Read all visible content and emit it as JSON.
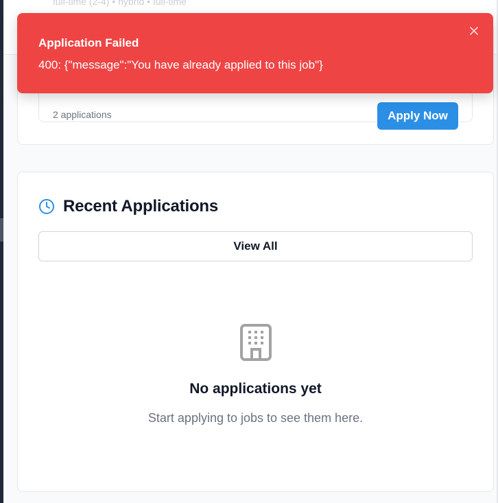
{
  "top_bar": {
    "faded_text": "full-time (2-4) • hybrid • full-time"
  },
  "job_card": {
    "applications_count": "2 applications",
    "apply_button_label": "Apply Now"
  },
  "toast": {
    "title": "Application Failed",
    "message": "400: {\"message\":\"You have already applied to this job\"}",
    "close_icon": "close-icon",
    "color": "#ef4444"
  },
  "recent_applications": {
    "icon": "clock-icon",
    "title": "Recent Applications",
    "view_all_label": "View All",
    "empty_icon": "building-icon",
    "empty_title": "No applications yet",
    "empty_subtitle": "Start applying to jobs to see them here."
  },
  "colors": {
    "accent": "#2b8fe6",
    "error": "#ef4444",
    "muted_text": "#6b7280"
  }
}
